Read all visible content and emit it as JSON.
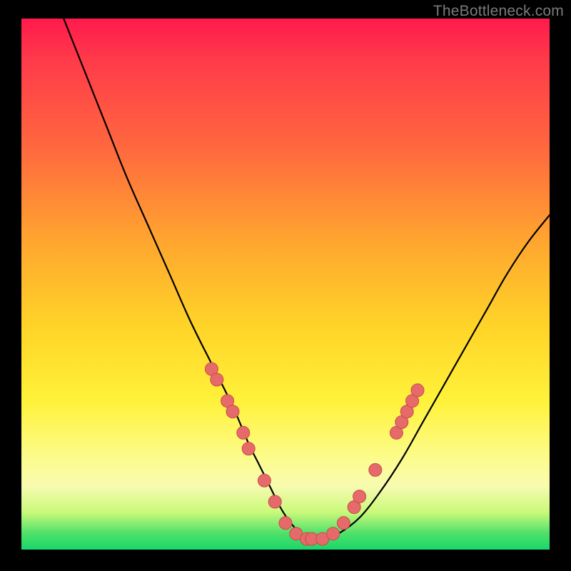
{
  "watermark": "TheBottleneck.com",
  "colors": {
    "background": "#000000",
    "curve_stroke": "#000000",
    "point_fill": "#e76a6a",
    "point_stroke": "#c64a4a",
    "gradient_stops": [
      "#ff1a4d",
      "#ff3b4a",
      "#ff6a3e",
      "#ffa62f",
      "#ffd428",
      "#fff23a",
      "#fcfc8e",
      "#f8fbb0",
      "#c9f97a",
      "#4de06a",
      "#19d76a"
    ]
  },
  "chart_data": {
    "type": "line",
    "title": "",
    "xlabel": "",
    "ylabel": "",
    "xlim": [
      0,
      100
    ],
    "ylim": [
      0,
      100
    ],
    "grid": false,
    "legend": false,
    "series": [
      {
        "name": "curve",
        "x": [
          8,
          12,
          16,
          20,
          24,
          28,
          32,
          36,
          40,
          43,
          45,
          47,
          49,
          51,
          53,
          55,
          57,
          60,
          64,
          68,
          72,
          76,
          80,
          84,
          88,
          92,
          96,
          100
        ],
        "y": [
          100,
          90,
          80,
          70,
          61,
          52,
          43,
          35,
          27,
          20,
          16,
          12,
          8,
          5,
          3,
          2,
          2,
          3,
          6,
          11,
          17,
          24,
          31,
          38,
          45,
          52,
          58,
          63
        ]
      }
    ],
    "points": [
      {
        "x": 36,
        "y": 34
      },
      {
        "x": 37,
        "y": 32
      },
      {
        "x": 39,
        "y": 28
      },
      {
        "x": 40,
        "y": 26
      },
      {
        "x": 42,
        "y": 22
      },
      {
        "x": 43,
        "y": 19
      },
      {
        "x": 46,
        "y": 13
      },
      {
        "x": 48,
        "y": 9
      },
      {
        "x": 50,
        "y": 5
      },
      {
        "x": 52,
        "y": 3
      },
      {
        "x": 54,
        "y": 2
      },
      {
        "x": 55,
        "y": 2
      },
      {
        "x": 57,
        "y": 2
      },
      {
        "x": 59,
        "y": 3
      },
      {
        "x": 61,
        "y": 5
      },
      {
        "x": 63,
        "y": 8
      },
      {
        "x": 64,
        "y": 10
      },
      {
        "x": 67,
        "y": 15
      },
      {
        "x": 71,
        "y": 22
      },
      {
        "x": 72,
        "y": 24
      },
      {
        "x": 73,
        "y": 26
      },
      {
        "x": 74,
        "y": 28
      },
      {
        "x": 75,
        "y": 30
      }
    ]
  }
}
